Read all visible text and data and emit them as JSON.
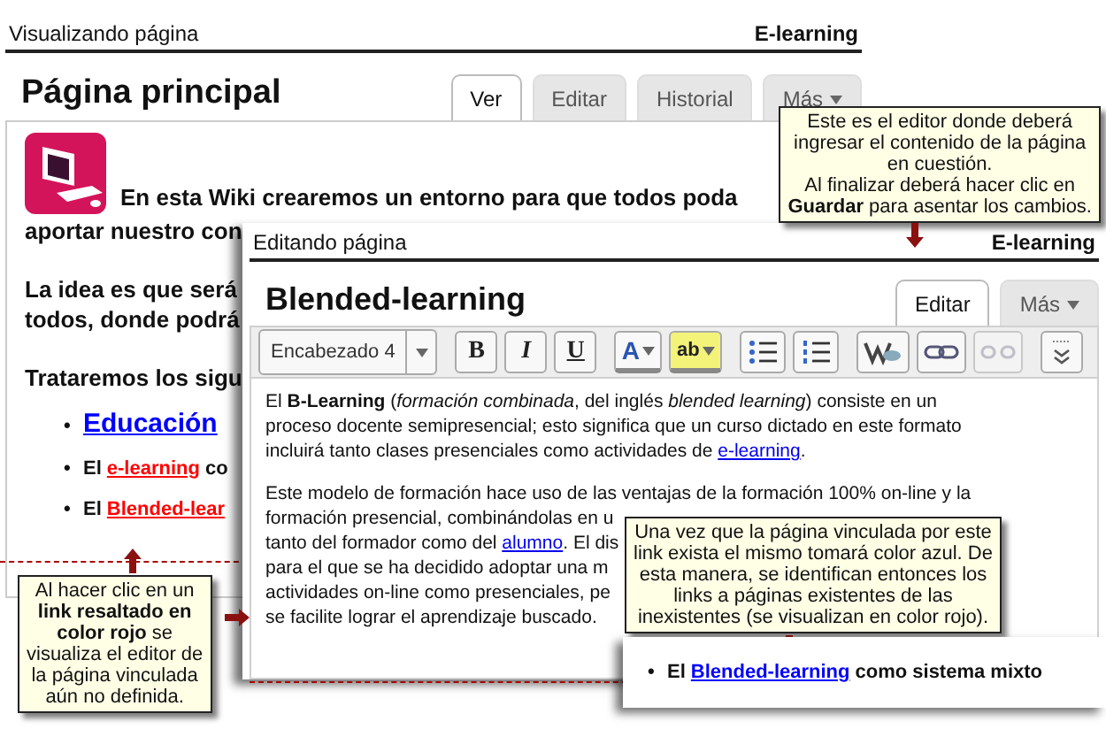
{
  "page": {
    "mode": "Visualizando página",
    "site": "E-learning",
    "title": "Página principal",
    "tabs": [
      {
        "label": "Ver",
        "selected": true,
        "kind": "tab"
      },
      {
        "label": "Editar",
        "selected": false,
        "kind": "tab"
      },
      {
        "label": "Historial",
        "selected": false,
        "kind": "tab"
      },
      {
        "label": "Más",
        "selected": false,
        "kind": "menu"
      }
    ],
    "intro": [
      "En esta Wiki crearemos un entorno para que todos poda",
      "aportar nuestro con"
    ],
    "paragraph": [
      "La idea es que será",
      "todos, donde podrá"
    ],
    "list_intro": "Trataremos los sigu",
    "items": [
      {
        "kind": "heading",
        "bullet": "•",
        "link": "Educación",
        "color": "#0000ff"
      },
      {
        "kind": "text",
        "bullet": "•",
        "prefix": "El",
        "link": "e-learning",
        "rest": "co",
        "color": "#ff0000"
      },
      {
        "kind": "text",
        "bullet": "•",
        "prefix": "El",
        "link": "Blended-lear",
        "color": "#ff0000"
      }
    ]
  },
  "editor": {
    "mode": "Editando página",
    "site": "E-learning",
    "title": "Blended-learning",
    "tabs": [
      {
        "label": "Editar",
        "selected": true,
        "kind": "tab"
      },
      {
        "label": "Más",
        "selected": false,
        "kind": "menu"
      }
    ],
    "format": "Encabezado 4",
    "tools": [
      {
        "kind": "bold",
        "label": "B",
        "disabled": false
      },
      {
        "kind": "italic",
        "label": "I",
        "disabled": false
      },
      {
        "kind": "underline",
        "label": "U",
        "disabled": false
      },
      {
        "kind": "font-color",
        "label": "A",
        "disabled": false
      },
      {
        "kind": "highlight",
        "label": "ab",
        "disabled": false
      },
      {
        "kind": "bullets",
        "disabled": false
      },
      {
        "kind": "numbers",
        "disabled": false
      },
      {
        "kind": "wiki",
        "disabled": false
      },
      {
        "kind": "link",
        "disabled": false
      },
      {
        "kind": "unlink",
        "disabled": true
      },
      {
        "kind": "more",
        "disabled": false
      }
    ],
    "paragraphs": [
      {
        "lines": [
          {
            "text": "El **B-Learning** (*formación combinada*, del inglés *blended learning*) consiste en un"
          },
          {
            "text": "proceso docente semipresencial; esto significa que un curso dictado en este formato"
          },
          {
            "text": "incluirá tanto clases presenciales como actividades de ",
            "link": "e-learning",
            "after": "."
          }
        ]
      },
      {
        "lines": [
          {
            "text": "Este modelo de formación hace uso de las ventajas de la formación 100% on-line y la"
          },
          {
            "text": "formación presencial, combinándolas en u"
          },
          {
            "text": "tanto del formador como del ",
            "link": "alumno",
            "after": ". El dis"
          },
          {
            "text": "para el que se ha decidido adoptar una m"
          },
          {
            "text": "actividades on-line como presenciales, pe"
          },
          {
            "text": "se facilite lograr el aprendizaje buscado."
          }
        ]
      }
    ]
  },
  "callouts": [
    {
      "kind": "top",
      "lines": [
        "Este es el editor donde deberá",
        "ingresar el contenido de la página",
        "en cuestión.",
        "Al finalizar deberá hacer clic en",
        "**Guardar** para asentar los cambios."
      ]
    },
    {
      "kind": "middle",
      "lines": [
        "Una vez que la página vinculada por este",
        "link exista el mismo tomará color azul. De",
        "esta manera, se identifican entonces los",
        "links a páginas existentes de las",
        "inexistentes (se visualizan en color rojo)."
      ]
    },
    {
      "kind": "left",
      "lines": [
        "Al hacer clic en un",
        "**link resaltado en**",
        "**color rojo** se",
        "visualiza el editor de",
        "la página vinculada",
        "aún no definida."
      ]
    }
  ],
  "inset": {
    "bullet": "•",
    "prefix": "El",
    "link": "Blended-learning",
    "rest": "como sistema mixto",
    "color": "#0000ff"
  }
}
